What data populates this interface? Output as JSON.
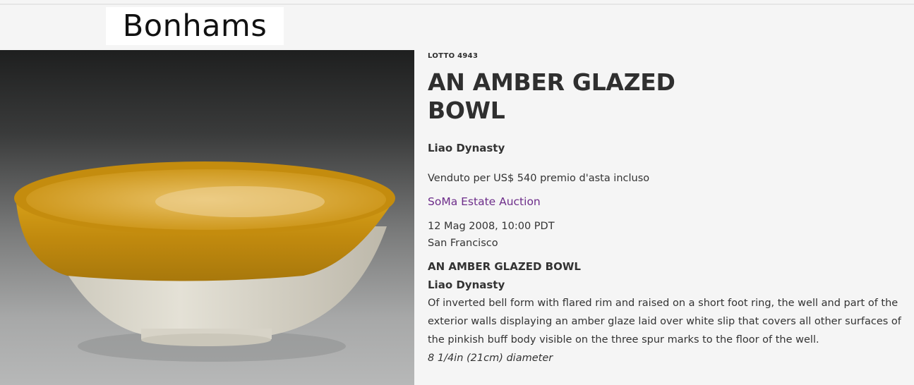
{
  "header": {
    "logo_text": "Bonhams"
  },
  "lot": {
    "label": "LOTTO 4943",
    "title_line1": "AN AMBER GLAZED",
    "title_line2": "BOWL",
    "dynasty": "Liao Dynasty",
    "sold_text": "Venduto per US$ 540 premio d'asta incluso",
    "sale_name": "SoMa Estate Auction",
    "sale_date": "12 Mag 2008, 10:00 PDT",
    "sale_location": "San Francisco"
  },
  "description": {
    "title": "AN AMBER GLAZED BOWL",
    "dynasty": "Liao Dynasty",
    "body": "Of inverted bell form with flared rim and raised on a short foot ring, the well and part of the exterior walls displaying an amber glaze laid over white slip that covers all other surfaces of the pinkish buff body visible on the three spur marks to the floor of the well.",
    "dimensions": "8 1/4in (21cm) diameter"
  },
  "colors": {
    "accent_link": "#6d2d8a",
    "amber_glaze": "#c9920f",
    "white_slip": "#d9d6cc"
  }
}
